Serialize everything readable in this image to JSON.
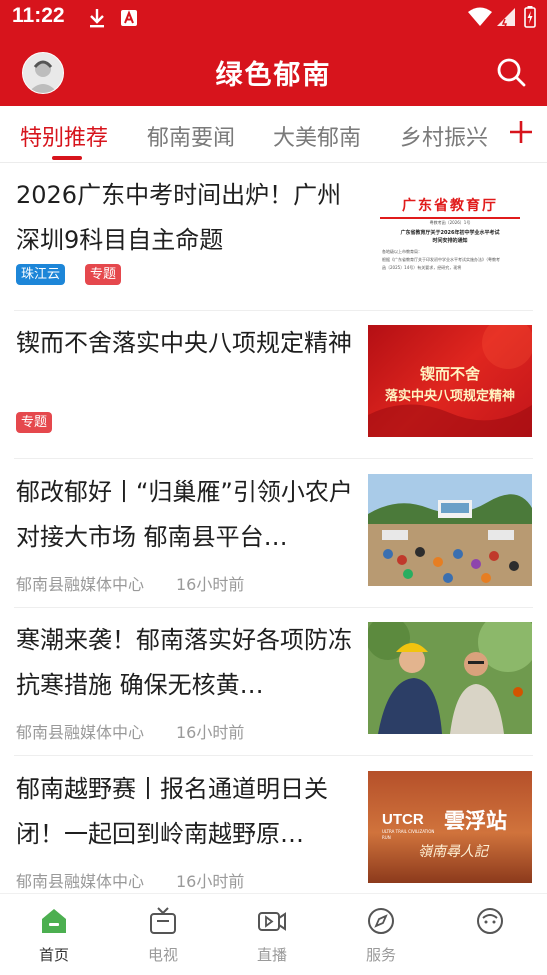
{
  "status_bar": {
    "time": "11:22"
  },
  "header": {
    "title": "绿色郁南"
  },
  "tabs": [
    {
      "label": "特别推荐"
    },
    {
      "label": "郁南要闻"
    },
    {
      "label": "大美郁南"
    },
    {
      "label": "乡村振兴"
    }
  ],
  "articles": [
    {
      "title": "2026广东中考时间出炉！广州深圳9科目自主命题",
      "tags": [
        "珠江云",
        "专题"
      ],
      "thumb": {
        "heading": "广东省教育厅",
        "line1": "粤教考函〔2026〕1号",
        "line2": "广东省教育厅关于2026年初中学业水平考试",
        "line3": "时间安排的通知",
        "line4": "各地级以上市教育局：",
        "line5": "根据《广东省教育厅关于印发初中学业水平考试实施办法》（粤教考",
        "line6": "函〔2025〕14号）有关要求，经研究，现将"
      }
    },
    {
      "title": "锲而不舍落实中央八项规定精神",
      "tags": [
        "专题"
      ],
      "thumb": {
        "line1": "锲而不舍",
        "line2": "落实中央八项规定精神"
      }
    },
    {
      "title": "郁改郁好丨“归巢雁”引领小农户对接大市场 郁南县平台…",
      "source": "郁南县融媒体中心",
      "time": "16小时前"
    },
    {
      "title": "寒潮来袭！郁南落实好各项防冻抗寒措施 确保无核黄…",
      "source": "郁南县融媒体中心",
      "time": "16小时前"
    },
    {
      "title": "郁南越野赛丨报名通道明日关闭！一起回到岭南越野原…",
      "source": "郁南县融媒体中心",
      "time": "16小时前",
      "thumb": {
        "brand": "UTCR",
        "sub": "ULTRA TRAIL CIVILIZATION RUN",
        "station": "雲浮站",
        "script": "嶺南尋人記"
      }
    }
  ],
  "bottom_nav": [
    {
      "label": "首页"
    },
    {
      "label": "电视"
    },
    {
      "label": "直播"
    },
    {
      "label": "服务"
    },
    {
      "label": ""
    }
  ],
  "colors": {
    "brand_red": "#d7141c",
    "tag_blue": "#1d86d8",
    "tag_red": "#e5484d",
    "nav_active_green": "#4caf50"
  },
  "icons": [
    "download-icon",
    "a-notification-icon",
    "wifi-icon",
    "signal-icon",
    "battery-icon",
    "avatar",
    "search-icon",
    "plus-icon",
    "home-icon",
    "tv-icon",
    "live-icon",
    "compass-icon",
    "profile-icon"
  ]
}
